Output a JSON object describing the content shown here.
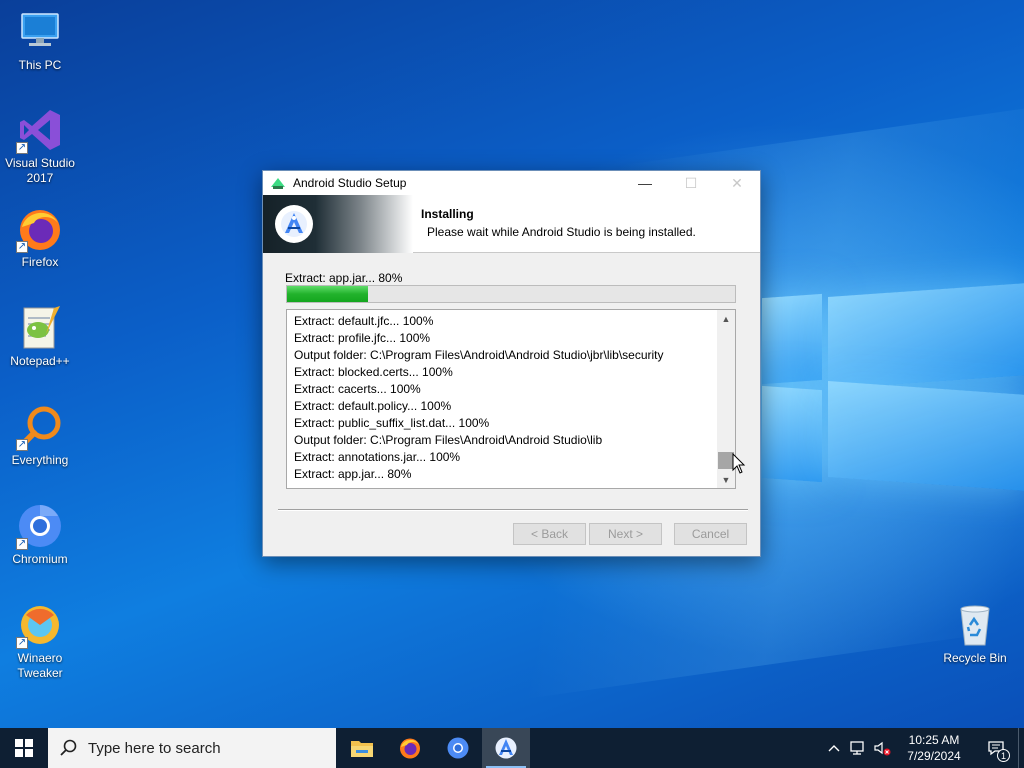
{
  "desktop": {
    "icons": [
      {
        "label": "This PC",
        "icon": "computer-icon"
      },
      {
        "label": "Visual Studio 2017",
        "icon": "visual-studio-icon"
      },
      {
        "label": "Firefox",
        "icon": "firefox-icon"
      },
      {
        "label": "Notepad++",
        "icon": "notepad-plus-plus-icon"
      },
      {
        "label": "Everything",
        "icon": "everything-search-icon"
      },
      {
        "label": "Chromium",
        "icon": "chromium-icon"
      },
      {
        "label": "Winaero Tweaker",
        "icon": "winaero-tweaker-icon"
      },
      {
        "label": "Recycle Bin",
        "icon": "recycle-bin-icon"
      }
    ]
  },
  "window": {
    "title": "Android Studio Setup",
    "header": {
      "title": "Installing",
      "subtitle": "Please wait while Android Studio is being installed."
    },
    "status": "Extract: app.jar... 80%",
    "progress_fraction": 0.18,
    "log": [
      "Extract: default.jfc... 100%",
      "Extract: profile.jfc... 100%",
      "Output folder: C:\\Program Files\\Android\\Android Studio\\jbr\\lib\\security",
      "Extract: blocked.certs... 100%",
      "Extract: cacerts... 100%",
      "Extract: default.policy... 100%",
      "Extract: public_suffix_list.dat... 100%",
      "Output folder: C:\\Program Files\\Android\\Android Studio\\lib",
      "Extract: annotations.jar... 100%",
      "Extract: app.jar... 80%"
    ],
    "buttons": {
      "back": "< Back",
      "next": "Next >",
      "cancel": "Cancel"
    }
  },
  "taskbar": {
    "search_placeholder": "Type here to search",
    "apps": [
      "file-explorer-icon",
      "firefox-icon",
      "chromium-icon",
      "android-studio-setup-icon"
    ],
    "clock": {
      "time": "10:25 AM",
      "date": "7/29/2024"
    },
    "notification_count": "1"
  },
  "colors": {
    "progress_green": "#22b32c",
    "taskbar": "#0e1f33",
    "wallpaper_blue": "#0b5fc8"
  }
}
